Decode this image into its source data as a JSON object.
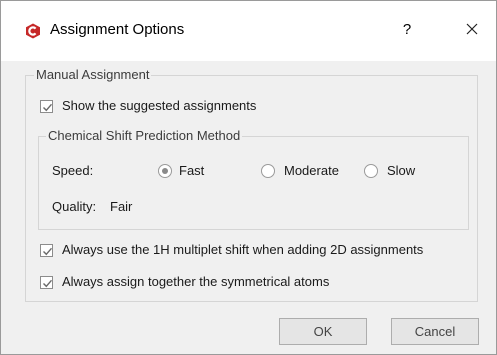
{
  "window": {
    "title": "Assignment Options",
    "help_label": "?",
    "icons": {
      "app": "app-logo-icon",
      "close": "close-icon"
    }
  },
  "manual_assignment": {
    "legend": "Manual Assignment",
    "show_suggested": {
      "label": "Show the suggested assignments",
      "checked": true
    },
    "prediction": {
      "legend": "Chemical Shift Prediction Method",
      "speed_label": "Speed:",
      "options": [
        {
          "label": "Fast",
          "selected": true
        },
        {
          "label": "Moderate",
          "selected": false
        },
        {
          "label": "Slow",
          "selected": false
        }
      ],
      "quality_label": "Quality:",
      "quality_value": "Fair"
    }
  },
  "options": {
    "use_1h_multiplet": {
      "label": "Always use the 1H multiplet shift when adding 2D assignments",
      "checked": true
    },
    "assign_symmetrical": {
      "label": "Always assign together the symmetrical atoms",
      "checked": true
    }
  },
  "buttons": {
    "ok": "OK",
    "cancel": "Cancel"
  },
  "colors": {
    "accent": "#c62828",
    "dialog_bg": "#f0f0f0",
    "title_bg": "#ffffff"
  }
}
